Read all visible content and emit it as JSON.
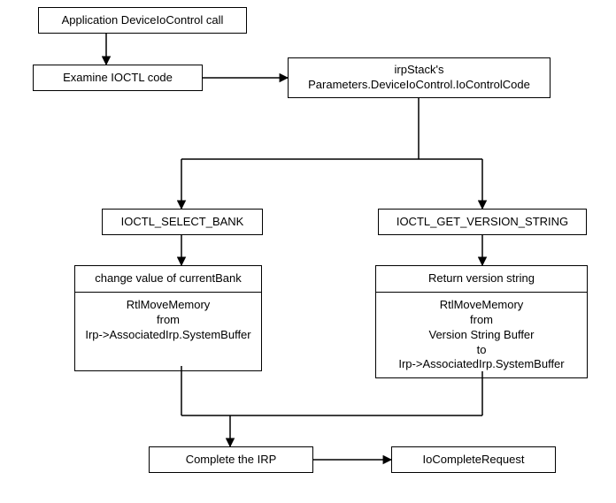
{
  "nodes": {
    "app_call": "Application DeviceIoControl call",
    "examine": "Examine IOCTL code",
    "irpstack": "irpStack's Parameters.DeviceIoControl.IoControlCode",
    "select_bank": "IOCTL_SELECT_BANK",
    "get_version": "IOCTL_GET_VERSION_STRING",
    "left_box_title": "change value of currentBank",
    "left_box_body": "RtlMoveMemory\nfrom\nIrp->AssociatedIrp.SystemBuffer",
    "right_box_title": "Return version string",
    "right_box_body": "RtlMoveMemory\nfrom\nVersion String Buffer\nto\nIrp->AssociatedIrp.SystemBuffer",
    "complete_irp": "Complete the IRP",
    "iocomplete": "IoCompleteRequest"
  }
}
